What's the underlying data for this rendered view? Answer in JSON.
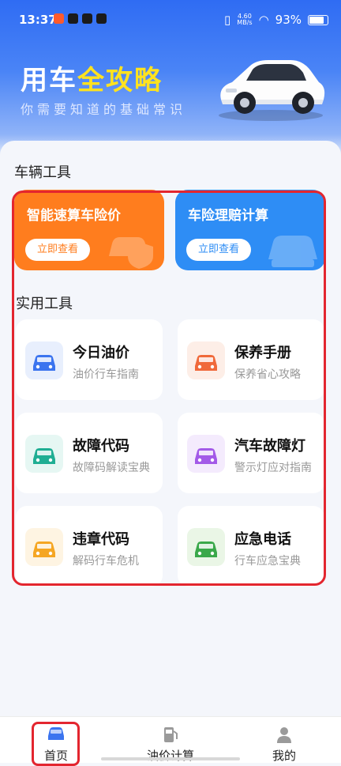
{
  "status": {
    "time": "13:37",
    "net_speed": "4.60\nMB/s",
    "battery": "93%"
  },
  "hero": {
    "title_part1": "用车",
    "title_highlight": "全攻略",
    "subtitle": "你需要知道的基础常识"
  },
  "sections": {
    "vehicle_tools": "车辆工具",
    "practical_tools": "实用工具"
  },
  "promos": [
    {
      "title": "智能速算车险价",
      "button": "立即查看",
      "color": "#ff7d1e"
    },
    {
      "title": "车险理赔计算",
      "button": "立即查看",
      "color": "#2e8df5"
    }
  ],
  "tools": [
    {
      "name": "今日油价",
      "desc": "油价行车指南",
      "icon": "car-fuel-icon",
      "bg": "#e8effd",
      "fg": "#3b74ef"
    },
    {
      "name": "保养手册",
      "desc": "保养省心攻略",
      "icon": "car-wrench-icon",
      "bg": "#fdeee7",
      "fg": "#f0693a"
    },
    {
      "name": "故障代码",
      "desc": "故障码解读宝典",
      "icon": "car-warning-icon",
      "bg": "#e6f7f3",
      "fg": "#1fae93"
    },
    {
      "name": "汽车故障灯",
      "desc": "警示灯应对指南",
      "icon": "car-light-icon",
      "bg": "#f4ebfd",
      "fg": "#a35ae8"
    },
    {
      "name": "违章代码",
      "desc": "解码行车危机",
      "icon": "car-violation-icon",
      "bg": "#fef4e2",
      "fg": "#f5a623"
    },
    {
      "name": "应急电话",
      "desc": "行车应急宝典",
      "icon": "car-phone-icon",
      "bg": "#eaf6e6",
      "fg": "#3aa84a"
    }
  ],
  "tabs": [
    {
      "label": "首页",
      "icon": "car-home-icon"
    },
    {
      "label": "油价计算",
      "icon": "fuel-pump-icon"
    },
    {
      "label": "我的",
      "icon": "user-profile-icon"
    }
  ]
}
